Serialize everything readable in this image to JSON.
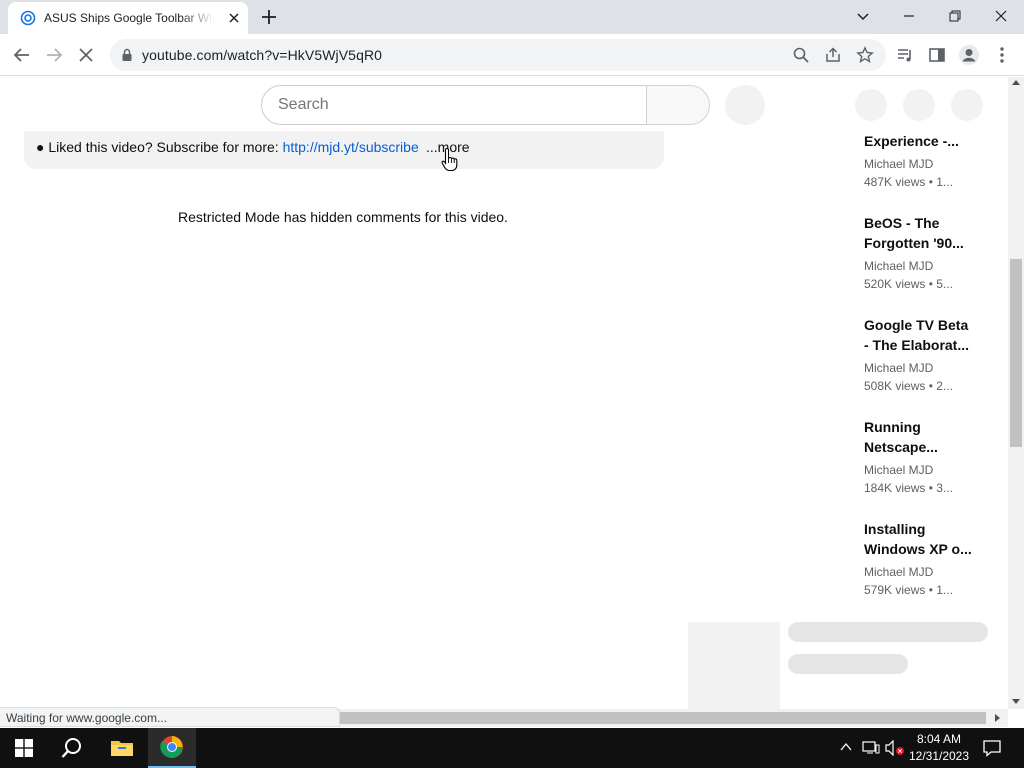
{
  "browser": {
    "tab_title": "ASUS Ships Google Toolbar With...",
    "url": "youtube.com/watch?v=HkV5WjV5qR0",
    "status_text": "Waiting for www.google.com..."
  },
  "youtube": {
    "search_placeholder": "Search",
    "description": {
      "prefix": "● Liked this video? Subscribe for more: ",
      "link": "http://mjd.yt/subscribe",
      "more": "...more"
    },
    "restricted_message": "Restricted Mode has hidden comments for this video.",
    "recommendations": [
      {
        "title_line1": "Experience -...",
        "title_line2": "",
        "channel": "Michael MJD",
        "meta": "487K views  • 1..."
      },
      {
        "title_line1": "BeOS - The",
        "title_line2": "Forgotten '90...",
        "channel": "Michael MJD",
        "meta": "520K views  • 5..."
      },
      {
        "title_line1": "Google TV Beta",
        "title_line2": "- The Elaborat...",
        "channel": "Michael MJD",
        "meta": "508K views  • 2..."
      },
      {
        "title_line1": "Running",
        "title_line2": "Netscape...",
        "channel": "Michael MJD",
        "meta": "184K views  • 3..."
      },
      {
        "title_line1": "Installing",
        "title_line2": "Windows XP o...",
        "channel": "Michael MJD",
        "meta": "579K views  • 1..."
      }
    ]
  },
  "taskbar": {
    "time": "8:04 AM",
    "date": "12/31/2023"
  },
  "colors": {
    "link": "#065fd4",
    "taskbar": "#101010",
    "chrome_tabstrip": "#dee1e6"
  }
}
